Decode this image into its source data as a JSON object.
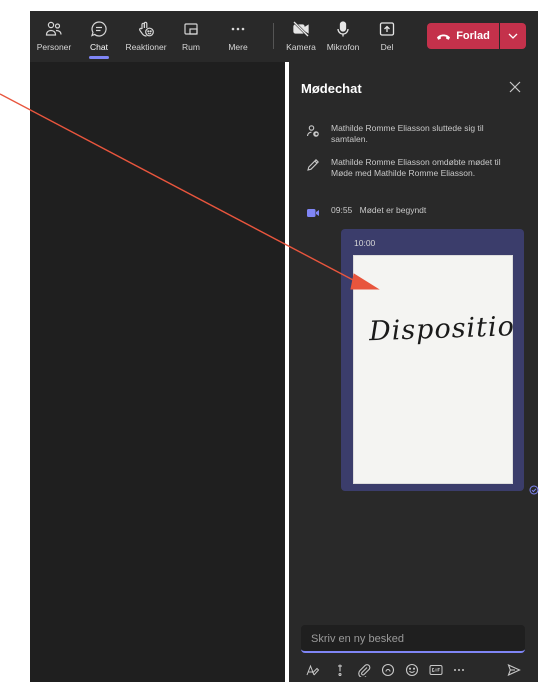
{
  "colors": {
    "toolbar_bg": "#292929",
    "stage_bg": "#1f1f1f",
    "chat_bg": "#292929",
    "accent": "#7f85f5",
    "leave_red": "#c4314b",
    "message_bubble": "#3b3d6b",
    "annotation_arrow": "#e8553d"
  },
  "toolbar": {
    "people": {
      "label": "Personer",
      "icon": "people-icon"
    },
    "chat": {
      "label": "Chat",
      "icon": "chat-icon"
    },
    "reactions": {
      "label": "Reaktioner",
      "icon": "reactions-icon"
    },
    "rooms": {
      "label": "Rum",
      "icon": "rooms-icon"
    },
    "more": {
      "label": "Mere",
      "icon": "more-icon"
    },
    "camera": {
      "label": "Kamera",
      "icon": "camera-off-icon"
    },
    "mic": {
      "label": "Mikrofon",
      "icon": "microphone-icon"
    },
    "share": {
      "label": "Del",
      "icon": "share-icon"
    },
    "leave": {
      "label": "Forlad",
      "icon": "phone-hangup-icon"
    }
  },
  "chat": {
    "title": "Mødechat",
    "events": [
      {
        "icon": "person-joined-icon",
        "text": "Mathilde Romme Eliasson sluttede sig til samtalen."
      },
      {
        "icon": "pencil-icon",
        "text": "Mathilde Romme Eliasson omdøbte mødet til Møde med Mathilde Romme Eliasson."
      },
      {
        "icon": "meeting-camera-icon",
        "time": "09:55",
        "text": "Mødet er begyndt"
      }
    ],
    "message": {
      "time": "10:00",
      "image_handwriting": "Disposition"
    },
    "compose": {
      "placeholder": "Skriv en ny besked"
    }
  }
}
